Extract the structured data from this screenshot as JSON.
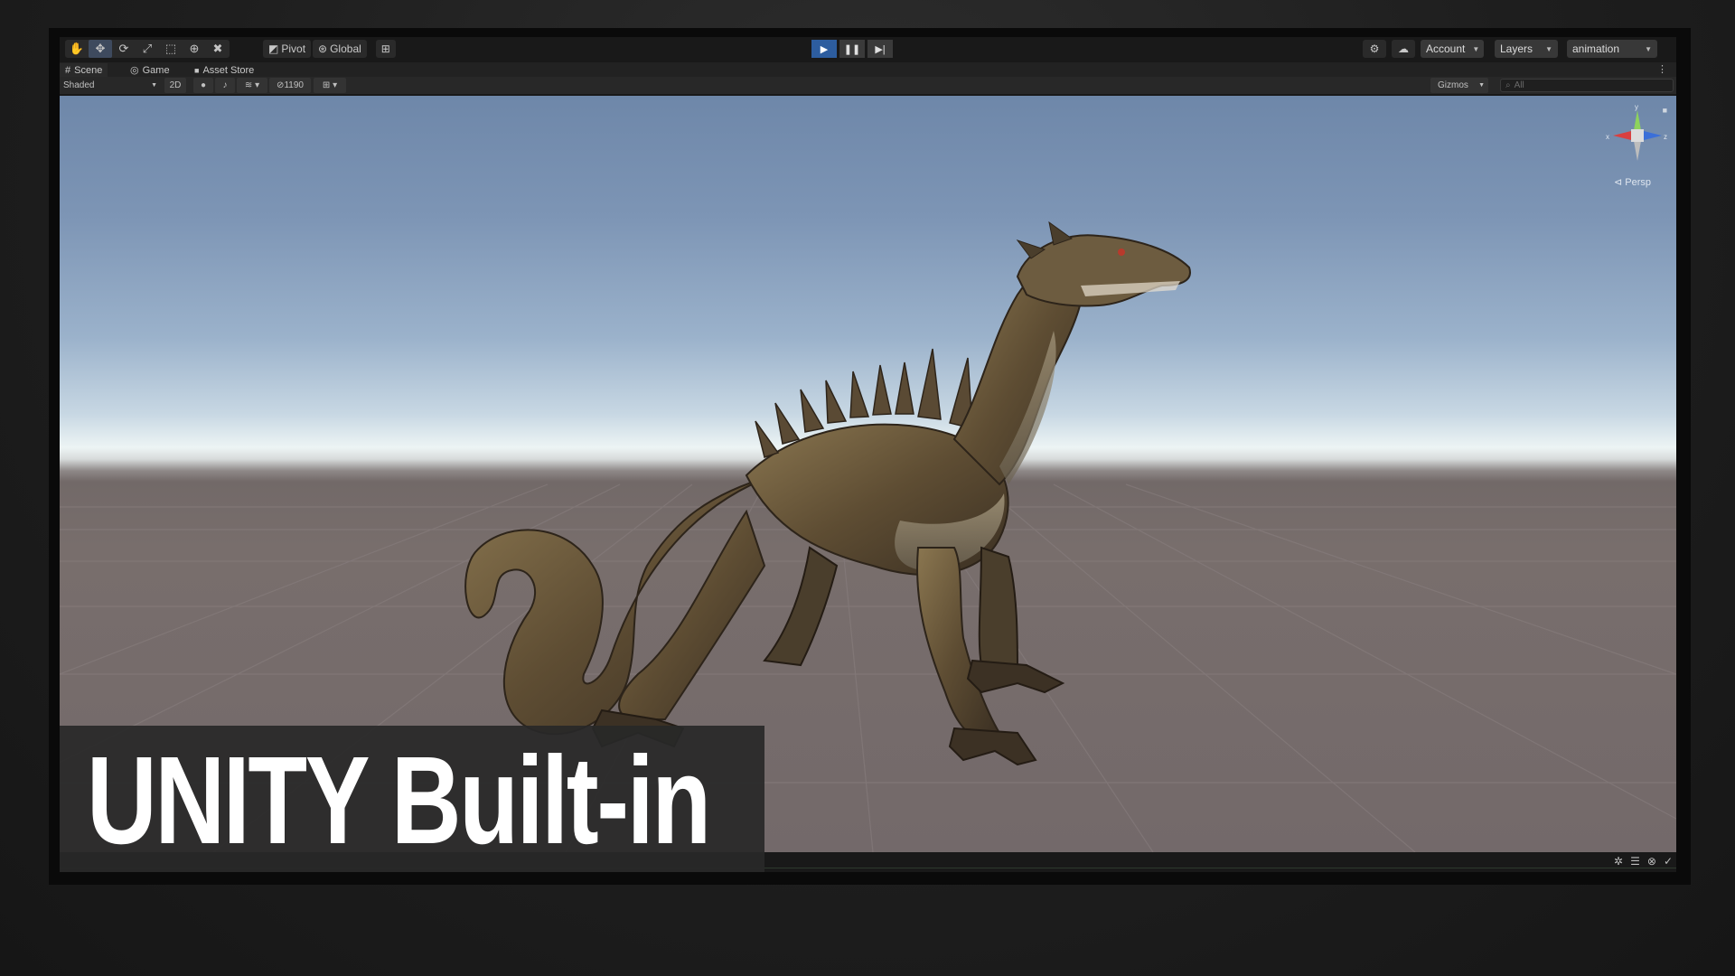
{
  "toolbar": {
    "tools": [
      {
        "name": "hand",
        "glyph": "✋"
      },
      {
        "name": "move",
        "glyph": "✥"
      },
      {
        "name": "rotate",
        "glyph": "⟳"
      },
      {
        "name": "scale",
        "glyph": "⤢"
      },
      {
        "name": "rect",
        "glyph": "⬚"
      },
      {
        "name": "transform",
        "glyph": "⊕"
      },
      {
        "name": "custom",
        "glyph": "✖"
      }
    ],
    "pivot_label": "Pivot",
    "global_label": "Global",
    "grid_snap_glyph": "⊞",
    "play": {
      "play": "▶",
      "pause": "❚❚",
      "step": "▶|"
    },
    "account_label": "Account",
    "layers_label": "Layers",
    "layout_label": "animation"
  },
  "tabs": [
    {
      "label": "Scene",
      "glyph": "#"
    },
    {
      "label": "Game",
      "glyph": "◎"
    },
    {
      "label": "Asset Store",
      "glyph": "🔒"
    }
  ],
  "scenebar": {
    "shading_mode": "Shaded",
    "mode_2d": "2D",
    "hidden_count": "1190",
    "gizmos_label": "Gizmos",
    "search_placeholder": "All"
  },
  "viewport": {
    "gizmo_axes": {
      "x": "x",
      "y": "y",
      "z": "z"
    },
    "persp_label": "Persp"
  },
  "overlay": {
    "title": "UNITY Built-in"
  }
}
